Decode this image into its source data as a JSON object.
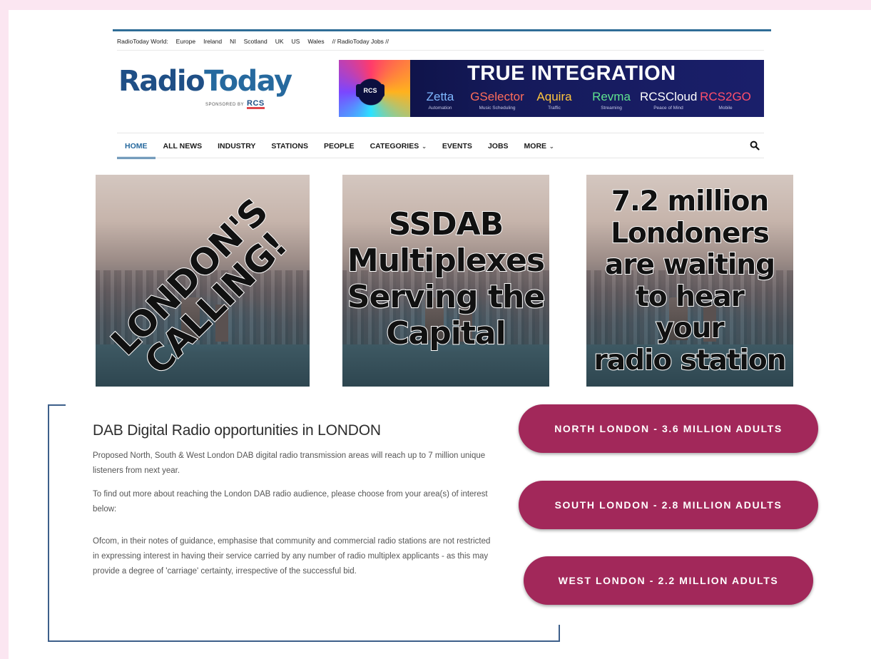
{
  "world_nav": {
    "label": "RadioToday World:",
    "items": [
      "Europe",
      "Ireland",
      "NI",
      "Scotland",
      "UK",
      "US",
      "Wales"
    ],
    "jobs_link": "// RadioToday Jobs //"
  },
  "logo": {
    "word_part1": "Radio",
    "word_part2": "Today",
    "sponsored_by": "SPONSORED BY",
    "sponsor_name": "RCS"
  },
  "banner": {
    "badge": "RCS",
    "headline": "TRUE INTEGRATION",
    "products": [
      {
        "name": "Zetta",
        "sub": "Automation",
        "color": "#7fb8ff"
      },
      {
        "name": "GSelector",
        "sub": "Music Scheduling",
        "color": "#ff6d5a"
      },
      {
        "name": "Aquira",
        "sub": "Traffic",
        "color": "#ffc53d"
      },
      {
        "name": "Revma",
        "sub": "Streaming",
        "color": "#5fe38f"
      },
      {
        "name": "RCSCloud",
        "sub": "Peace of Mind",
        "color": "#ffffff"
      },
      {
        "name": "RCS2GO",
        "sub": "Mobile",
        "color": "#ff4f6b"
      }
    ]
  },
  "main_nav": {
    "items": [
      {
        "label": "HOME",
        "active": true
      },
      {
        "label": "ALL NEWS"
      },
      {
        "label": "INDUSTRY"
      },
      {
        "label": "STATIONS"
      },
      {
        "label": "PEOPLE"
      },
      {
        "label": "CATEGORIES",
        "dropdown": true
      },
      {
        "label": "EVENTS"
      },
      {
        "label": "JOBS"
      },
      {
        "label": "MORE",
        "dropdown": true
      }
    ],
    "search_icon": "search-icon"
  },
  "tiles": [
    {
      "text": "LONDON'S\nCALLING!"
    },
    {
      "text": "SSDAB\nMultiplexes\nServing the\nCapital"
    },
    {
      "text": "7.2 million\nLondoners\nare waiting\nto hear\nyour\nradio station"
    }
  ],
  "section": {
    "heading": "DAB Digital Radio opportunities in LONDON",
    "para1": "Proposed North, South & West London DAB digital radio transmission areas will reach up to 7 million unique listeners from next year.",
    "para2": "To find out more about reaching the London DAB radio audience, please choose from your area(s) of interest below:",
    "para3": "Ofcom, in their notes of guidance, emphasise that community and commercial radio stations are not restricted in expressing interest in having their service carried by any number of radio multiplex applicants - as this may provide a degree of 'carriage' certainty, irrespective of the successful bid."
  },
  "cta_buttons": [
    {
      "label": "NORTH LONDON - 3.6 MILLION ADULTS"
    },
    {
      "label": "SOUTH LONDON - 2.8 MILLION ADULTS"
    },
    {
      "label": "WEST LONDON - 2.2 MILLION ADULTS"
    }
  ],
  "colors": {
    "brand_blue": "#26699e",
    "cta_magenta": "#a2285a",
    "page_bg": "#fbe6f1"
  }
}
